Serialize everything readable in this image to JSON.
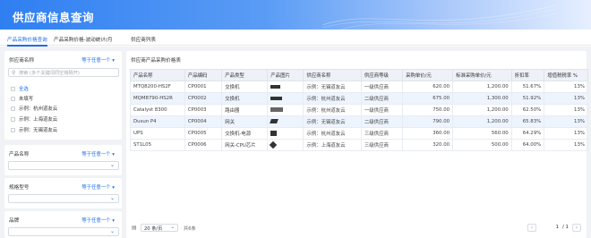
{
  "app": {
    "title": "供应商信息查询"
  },
  "tabs": [
    {
      "label": "产品采购价格查询"
    },
    {
      "label": "产品采购价格-波动统计/月"
    },
    {
      "label": "供应商列表"
    }
  ],
  "filters": {
    "supplier": {
      "label": "供应商名称",
      "link": "等于任意一个",
      "search_placeholder": "搜索 (多个关键词同空格隔开)",
      "options": [
        "全选",
        "未填写",
        "示例：杭州道友云",
        "示例：上海道友云",
        "示例：无锡道友云"
      ]
    },
    "product": {
      "label": "产品名称",
      "link": "等于任意一个"
    },
    "spec": {
      "label": "规格型号",
      "link": "等于任意一个"
    },
    "brand": {
      "label": "品牌",
      "link": "等于任意一个"
    }
  },
  "table": {
    "title": "供应商产品采购价格表",
    "columns": [
      "产品名称",
      "产品编码",
      "产品类型",
      "产品图片",
      "供应商名称",
      "供应商等级",
      "采购单价/元",
      "标准采购单价/元",
      "折扣率",
      "增值税税率 %"
    ],
    "rows": [
      [
        "MTQ8200-HS2F",
        "CP0001",
        "交换机",
        "",
        "示例：无锡道友云",
        "一级供应商",
        "620.00",
        "1,200.00",
        "51.67%",
        "13%"
      ],
      [
        "MQM8790-HS2R",
        "CP0002",
        "交换机",
        "",
        "示例：杭州道友云",
        "二级供应商",
        "675.00",
        "1,300.00",
        "51.92%",
        "13%"
      ],
      [
        "Catalyst 8300",
        "CP0003",
        "路由器",
        "",
        "示例：杭州道友云",
        "一级供应商",
        "750.00",
        "1,200.00",
        "62.50%",
        "13%"
      ],
      [
        "Dusun P4",
        "CP0004",
        "网关",
        "",
        "示例：无锡道友云",
        "二级供应商",
        "790.00",
        "1,200.00",
        "65.83%",
        "13%"
      ],
      [
        "UPS",
        "CP0005",
        "交换机-电源",
        "",
        "示例：杭州道友云",
        "三级供应商",
        "360.00",
        "560.00",
        "64.29%",
        "13%"
      ],
      [
        "ST1L05",
        "CP0006",
        "网关-CPU芯片",
        "",
        "示例：上海道友云",
        "三级供应商",
        "320.00",
        "500.00",
        "64.00%",
        "13%"
      ]
    ]
  },
  "footer": {
    "page_size": "20 条/页",
    "total": "共6条",
    "page": "1",
    "pages": "/ 1"
  },
  "colors": {
    "accent": "#1e6fe8",
    "header_start": "#2f7ff2",
    "header_end": "#e6efff",
    "highlight_row": "#eef4fe"
  }
}
